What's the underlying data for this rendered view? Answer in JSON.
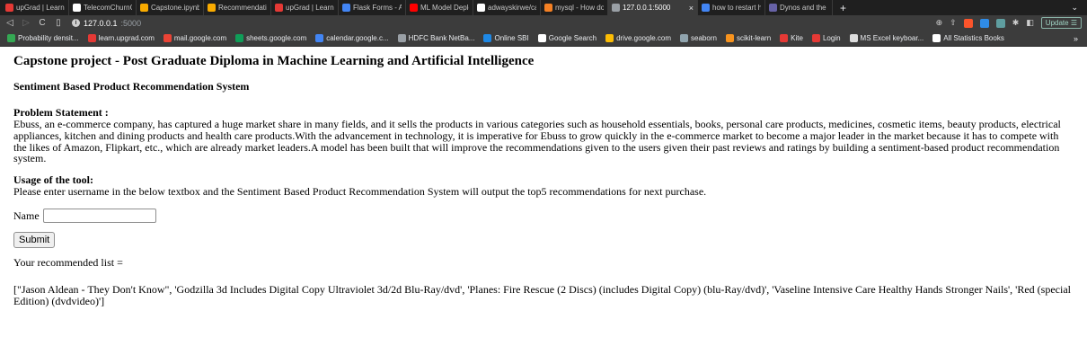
{
  "browser": {
    "tabs": [
      {
        "label": "upGrad | Learning P",
        "icon": "upgrad-icon",
        "color": "#e53935"
      },
      {
        "label": "TelecomChurnCase",
        "icon": "github-icon",
        "color": "#ffffff"
      },
      {
        "label": "Capstone.ipynb - C",
        "icon": "colab-icon",
        "color": "#f9ab00"
      },
      {
        "label": "Recommendation+S",
        "icon": "colab-icon",
        "color": "#f9ab00"
      },
      {
        "label": "upGrad | Learning P",
        "icon": "upgrad-icon",
        "color": "#e53935"
      },
      {
        "label": "Flask Forms - Acce",
        "icon": "flask-icon",
        "color": "#4285f4"
      },
      {
        "label": "ML Model Deployme",
        "icon": "youtube-icon",
        "color": "#ff0000"
      },
      {
        "label": "adwayskirwe/capsto",
        "icon": "github-icon",
        "color": "#ffffff"
      },
      {
        "label": "mysql - How do you",
        "icon": "stackoverflow-icon",
        "color": "#f48024"
      },
      {
        "label": "127.0.0.1:5000",
        "icon": "globe-icon",
        "color": "#9aa0a6",
        "active": true
      },
      {
        "label": "how to restart heroku",
        "icon": "google-icon",
        "color": "#4285f4"
      },
      {
        "label": "Dynos and the Dyno",
        "icon": "heroku-icon",
        "color": "#6762a6"
      }
    ],
    "new_tab": "+",
    "tab_close": "×",
    "url_host": "127.0.0.1",
    "url_port": ":5000",
    "update_label": "Update",
    "bookmarks": [
      {
        "label": "Probability densit...",
        "color": "#34a853"
      },
      {
        "label": "learn.upgrad.com",
        "color": "#e53935"
      },
      {
        "label": "mail.google.com",
        "color": "#ea4335"
      },
      {
        "label": "sheets.google.com",
        "color": "#0f9d58"
      },
      {
        "label": "calendar.google.c...",
        "color": "#4285f4"
      },
      {
        "label": "HDFC Bank NetBa...",
        "color": "#9aa0a6"
      },
      {
        "label": "Online SBI",
        "color": "#1e88e5"
      },
      {
        "label": "Google Search",
        "color": "#ffffff"
      },
      {
        "label": "drive.google.com",
        "color": "#fbbc04"
      },
      {
        "label": "seaborn",
        "color": "#90a4ae"
      },
      {
        "label": "scikit-learn",
        "color": "#f7931e"
      },
      {
        "label": "Kite",
        "color": "#e53935"
      },
      {
        "label": "Login",
        "color": "#e53935"
      },
      {
        "label": "MS Excel keyboar...",
        "color": "#dddddd"
      },
      {
        "label": "All Statistics Books",
        "color": "#ffffff"
      }
    ],
    "bookmarks_more": "»"
  },
  "page": {
    "title": "Capstone project - Post Graduate Diploma in Machine Learning and Artificial Intelligence",
    "subtitle": "Sentiment Based Product Recommendation System",
    "problem_title": "Problem Statement :",
    "problem_text": "Ebuss, an e-commerce company, has captured a huge market share in many fields, and it sells the products in various categories such as household essentials, books, personal care products, medicines, cosmetic items, beauty products, electrical appliances, kitchen and dining products and health care products.With the advancement in technology, it is imperative for Ebuss to grow quickly in the e-commerce market to become a major leader in the market because it has to compete with the likes of Amazon, Flipkart, etc., which are already market leaders.A model has been built that will improve the recommendations given to the users given their past reviews and ratings by building a sentiment-based product recommendation system.",
    "usage_title": "Usage of the tool:",
    "usage_text": "Please enter username in the below textbox and the Sentiment Based Product Recommendation System will output the top5 recommendations for next purchase.",
    "name_label": "Name",
    "name_value": "",
    "submit_label": "Submit",
    "result_label": "Your recommended list =",
    "result_text": "[\"Jason Aldean - They Don't Know\", 'Godzilla 3d Includes Digital Copy Ultraviolet 3d/2d Blu-Ray/dvd', 'Planes: Fire Rescue (2 Discs) (includes Digital Copy) (blu-Ray/dvd)', 'Vaseline Intensive Care Healthy Hands Stronger Nails', 'Red (special Edition) (dvdvideo)']"
  }
}
